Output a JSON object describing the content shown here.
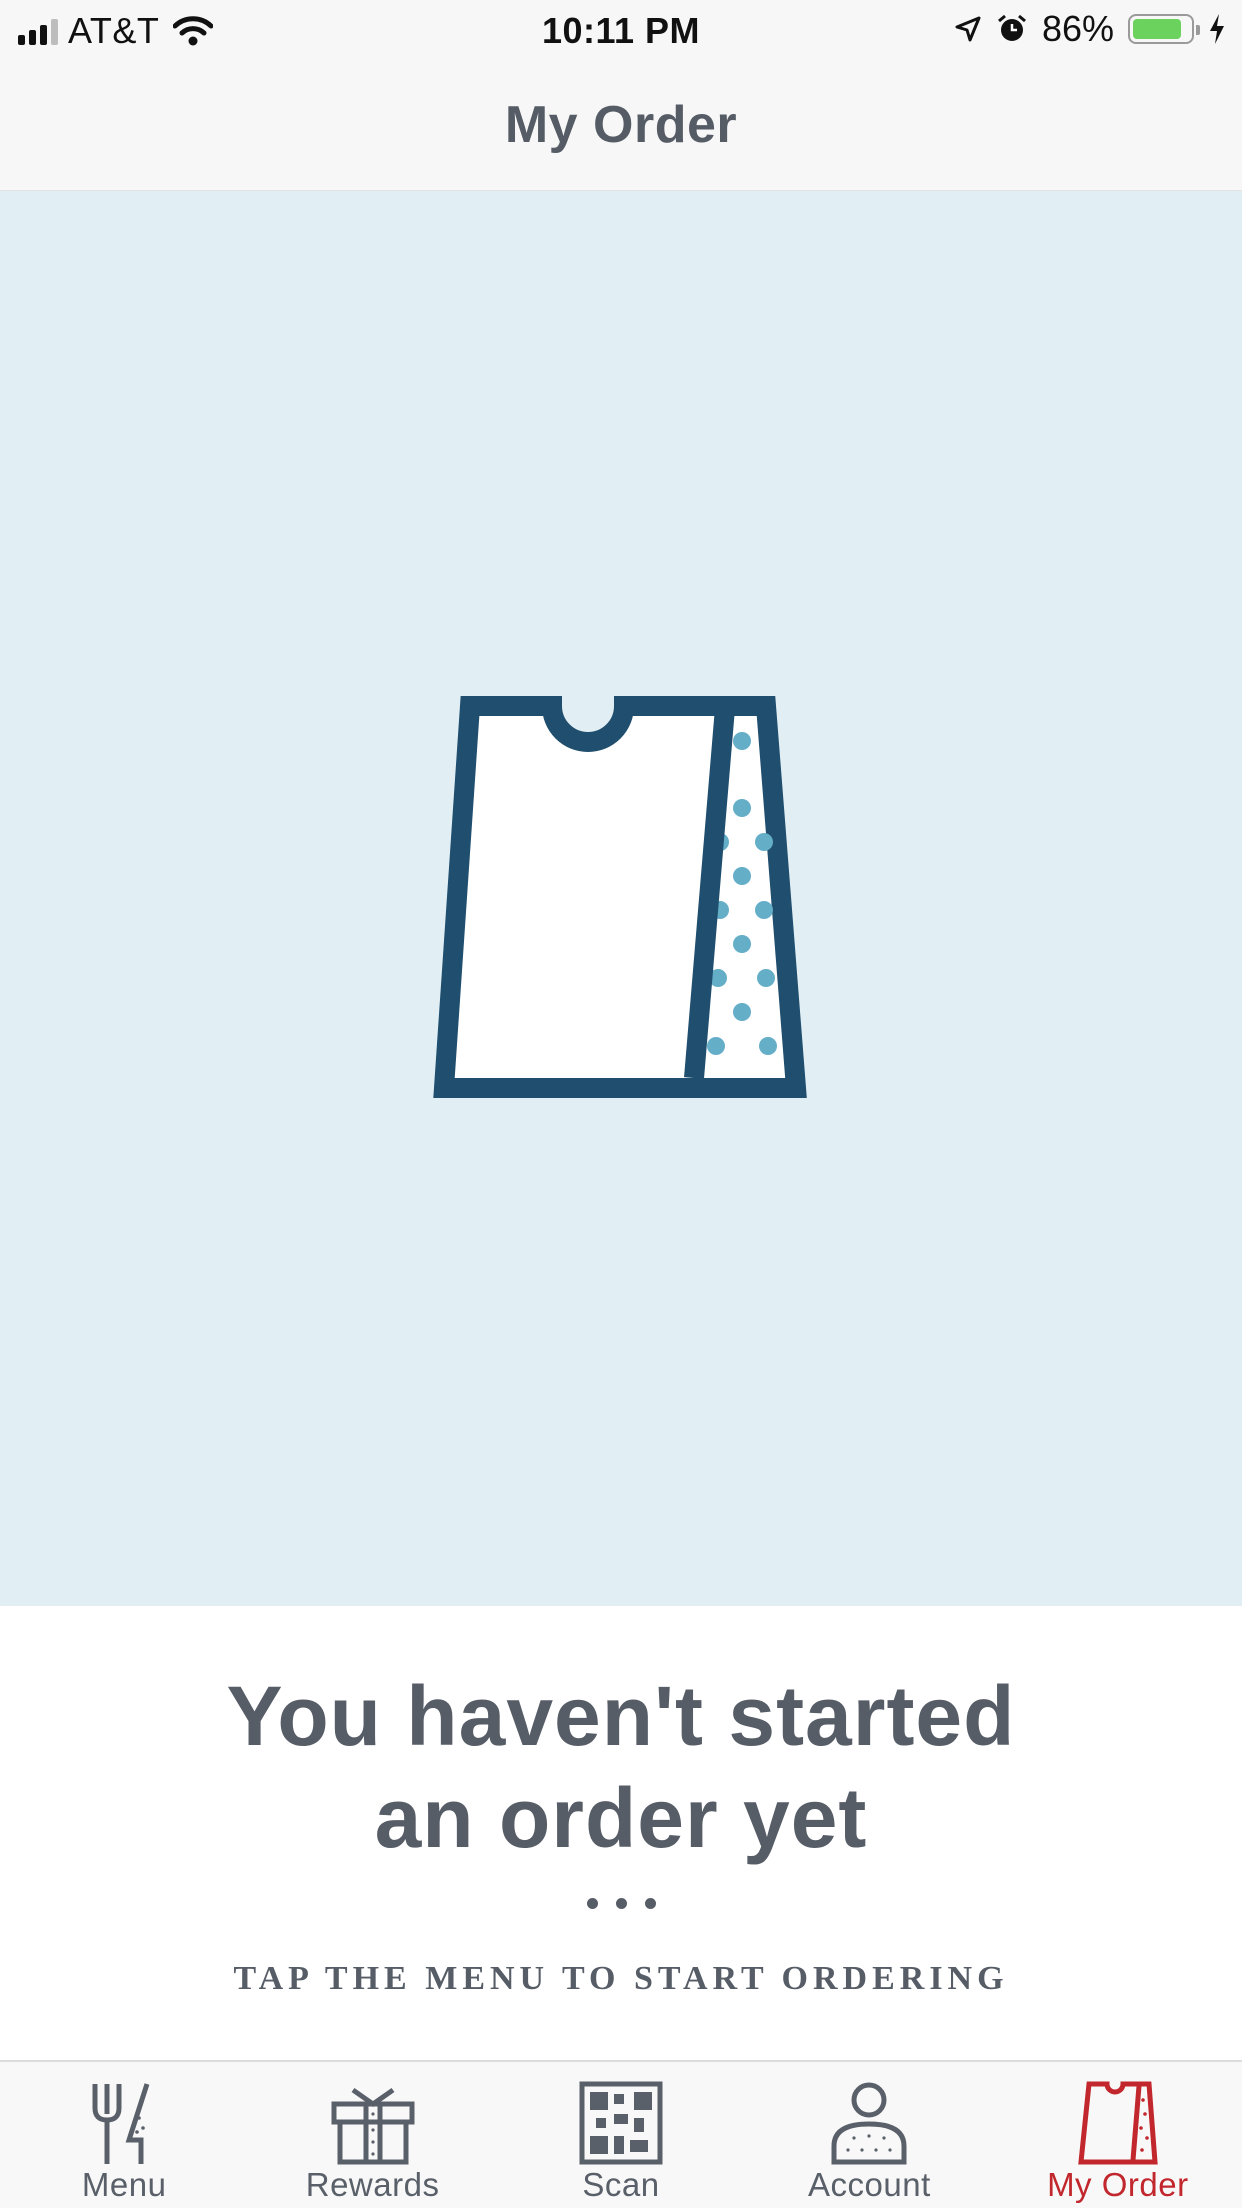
{
  "status_bar": {
    "carrier": "AT&T",
    "time": "10:11 PM",
    "battery_percent": "86%",
    "battery_level": 0.86,
    "icons": [
      "signal-icon",
      "wifi-icon",
      "location-icon",
      "alarm-icon",
      "battery-icon",
      "charging-icon"
    ]
  },
  "nav": {
    "title": "My Order"
  },
  "hero": {
    "illustration": "bag-icon",
    "colors": {
      "background": "#e1eff5",
      "stroke": "#1f4e6e",
      "dots": "#64aec8"
    }
  },
  "empty_state": {
    "title_line1": "You haven't started",
    "title_line2": "an order yet",
    "subtitle": "TAP THE MENU TO START ORDERING"
  },
  "tabs": [
    {
      "label": "Menu",
      "icon": "fork-knife-icon",
      "active": false
    },
    {
      "label": "Rewards",
      "icon": "gift-icon",
      "active": false
    },
    {
      "label": "Scan",
      "icon": "qr-code-icon",
      "active": false
    },
    {
      "label": "Account",
      "icon": "person-icon",
      "active": false
    },
    {
      "label": "My Order",
      "icon": "bag-icon",
      "active": true
    }
  ],
  "colors": {
    "accent": "#c1272d",
    "text": "#575d67",
    "tab_inactive": "#5a6069"
  }
}
